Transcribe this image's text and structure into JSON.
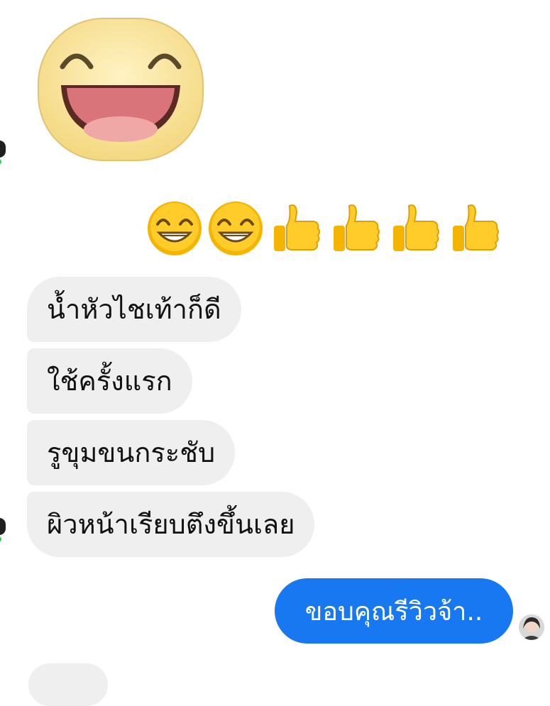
{
  "received_messages": [
    {
      "text": "น้ำหัวไชเท้าก็ดี"
    },
    {
      "text": "ใช้ครั้งแรก"
    },
    {
      "text": "รูขุมขนกระชับ"
    },
    {
      "text": "ผิวหน้าเรียบตึงขึ้นเลย"
    }
  ],
  "sent_message": {
    "text": "ขอบคุณรีวิวจ้า.."
  },
  "stickers": {
    "big": "laughing-face-sticker"
  },
  "emoji_row": [
    "grinning-face",
    "grinning-face",
    "thumbs-up",
    "thumbs-up",
    "thumbs-up",
    "thumbs-up"
  ],
  "colors": {
    "sent_bubble": "#1778f2",
    "received_bubble": "#efefef",
    "online": "#35c759"
  }
}
